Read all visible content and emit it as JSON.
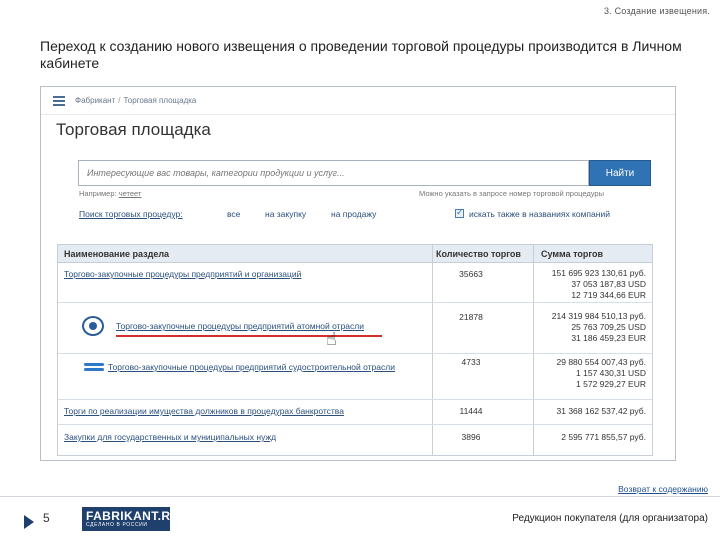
{
  "slide": {
    "section_title": "3. Создание извещения.",
    "intro": "Переход к созданию нового извещения о проведении торговой процедуры производится в Личном кабинете",
    "return_link": "Возврат к содержанию",
    "page_number": "5",
    "footer_caption": "Редукцион покупателя (для организатора)",
    "logo_text": "FABRIKANT.RU",
    "logo_sub": "СДЕЛАНО В РОССИИ"
  },
  "screenshot": {
    "breadcrumb": [
      "Фабрикант",
      "Торговая площадка"
    ],
    "title": "Торговая площадка",
    "search": {
      "placeholder": "Интересующие вас товары, категории продукции и услуг...",
      "button": "Найти"
    },
    "hint_left_prefix": "Например:",
    "hint_left_link": "четеет",
    "hint_right": "Можно указать в запросе номер торговой процедуры",
    "filter": {
      "label": "Поиск торговых процедур:",
      "all": "все",
      "buy": "на закупку",
      "sell": "на продажу",
      "names": "искать также в названиях компаний"
    },
    "table": {
      "headers": {
        "name": "Наименование раздела",
        "count": "Количество торгов",
        "sum": "Сумма торгов"
      },
      "rows": [
        {
          "name": "Торгово-закупочные процедуры предприятий и организаций",
          "count": "35663",
          "sums": [
            "151 695 923 130,61 руб.",
            "37 053 187,83 USD",
            "12 719 344,66 EUR"
          ]
        },
        {
          "name": "Торгово-закупочные процедуры предприятий атомной отрасли",
          "count": "21878",
          "sums": [
            "214 319 984 510,13 руб.",
            "25 763 709,25 USD",
            "31 186 459,23 EUR"
          ]
        },
        {
          "name": "Торгово-закупочные процедуры предприятий судостроительной отрасли",
          "count": "4733",
          "sums": [
            "29 880 554 007,43 руб.",
            "1 157 430,31 USD",
            "1 572 929,27 EUR"
          ]
        },
        {
          "name": "Торги по реализации имущества должников в процедурах банкротства",
          "count": "11444",
          "sums": [
            "31 368 162 537,42 руб."
          ]
        },
        {
          "name": "Закупки для государственных и муниципальных нужд",
          "count": "3896",
          "sums": [
            "2 595 771 855,57 руб."
          ]
        }
      ]
    }
  },
  "colors": {
    "accent": "#2f73b4",
    "brand": "#1f3f6d",
    "highlight": "#d32f2f"
  }
}
